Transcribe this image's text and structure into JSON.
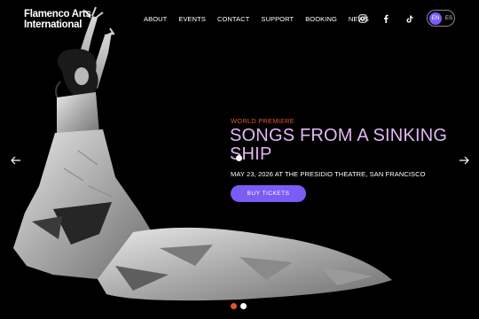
{
  "brand": {
    "line1": "Flamenco Arts",
    "line2": "International"
  },
  "nav": {
    "items": [
      "ABOUT",
      "EVENTS",
      "CONTACT",
      "SUPPORT",
      "BOOKING",
      "NEWS"
    ]
  },
  "social": [
    "instagram-icon",
    "facebook-icon",
    "tiktok-icon"
  ],
  "language": {
    "active": "EN",
    "inactive": "ES",
    "accent": "#7b5cf6"
  },
  "slide": {
    "kicker": "WORLD PREMIERE",
    "title": "SONGS FROM A SINKING SHIP",
    "date_line": "MAY 23, 2026 AT THE PRESIDIO THEATRE, SAN FRANCISCO",
    "cta_label": "BUY TICKETS",
    "kicker_color": "#e0532e",
    "title_color": "#e3b8f4",
    "cta_color": "#7b5cf6"
  },
  "carousel": {
    "slides": 2,
    "active_index": 0,
    "active_color": "#e0532e",
    "inactive_color": "#ffffff"
  }
}
